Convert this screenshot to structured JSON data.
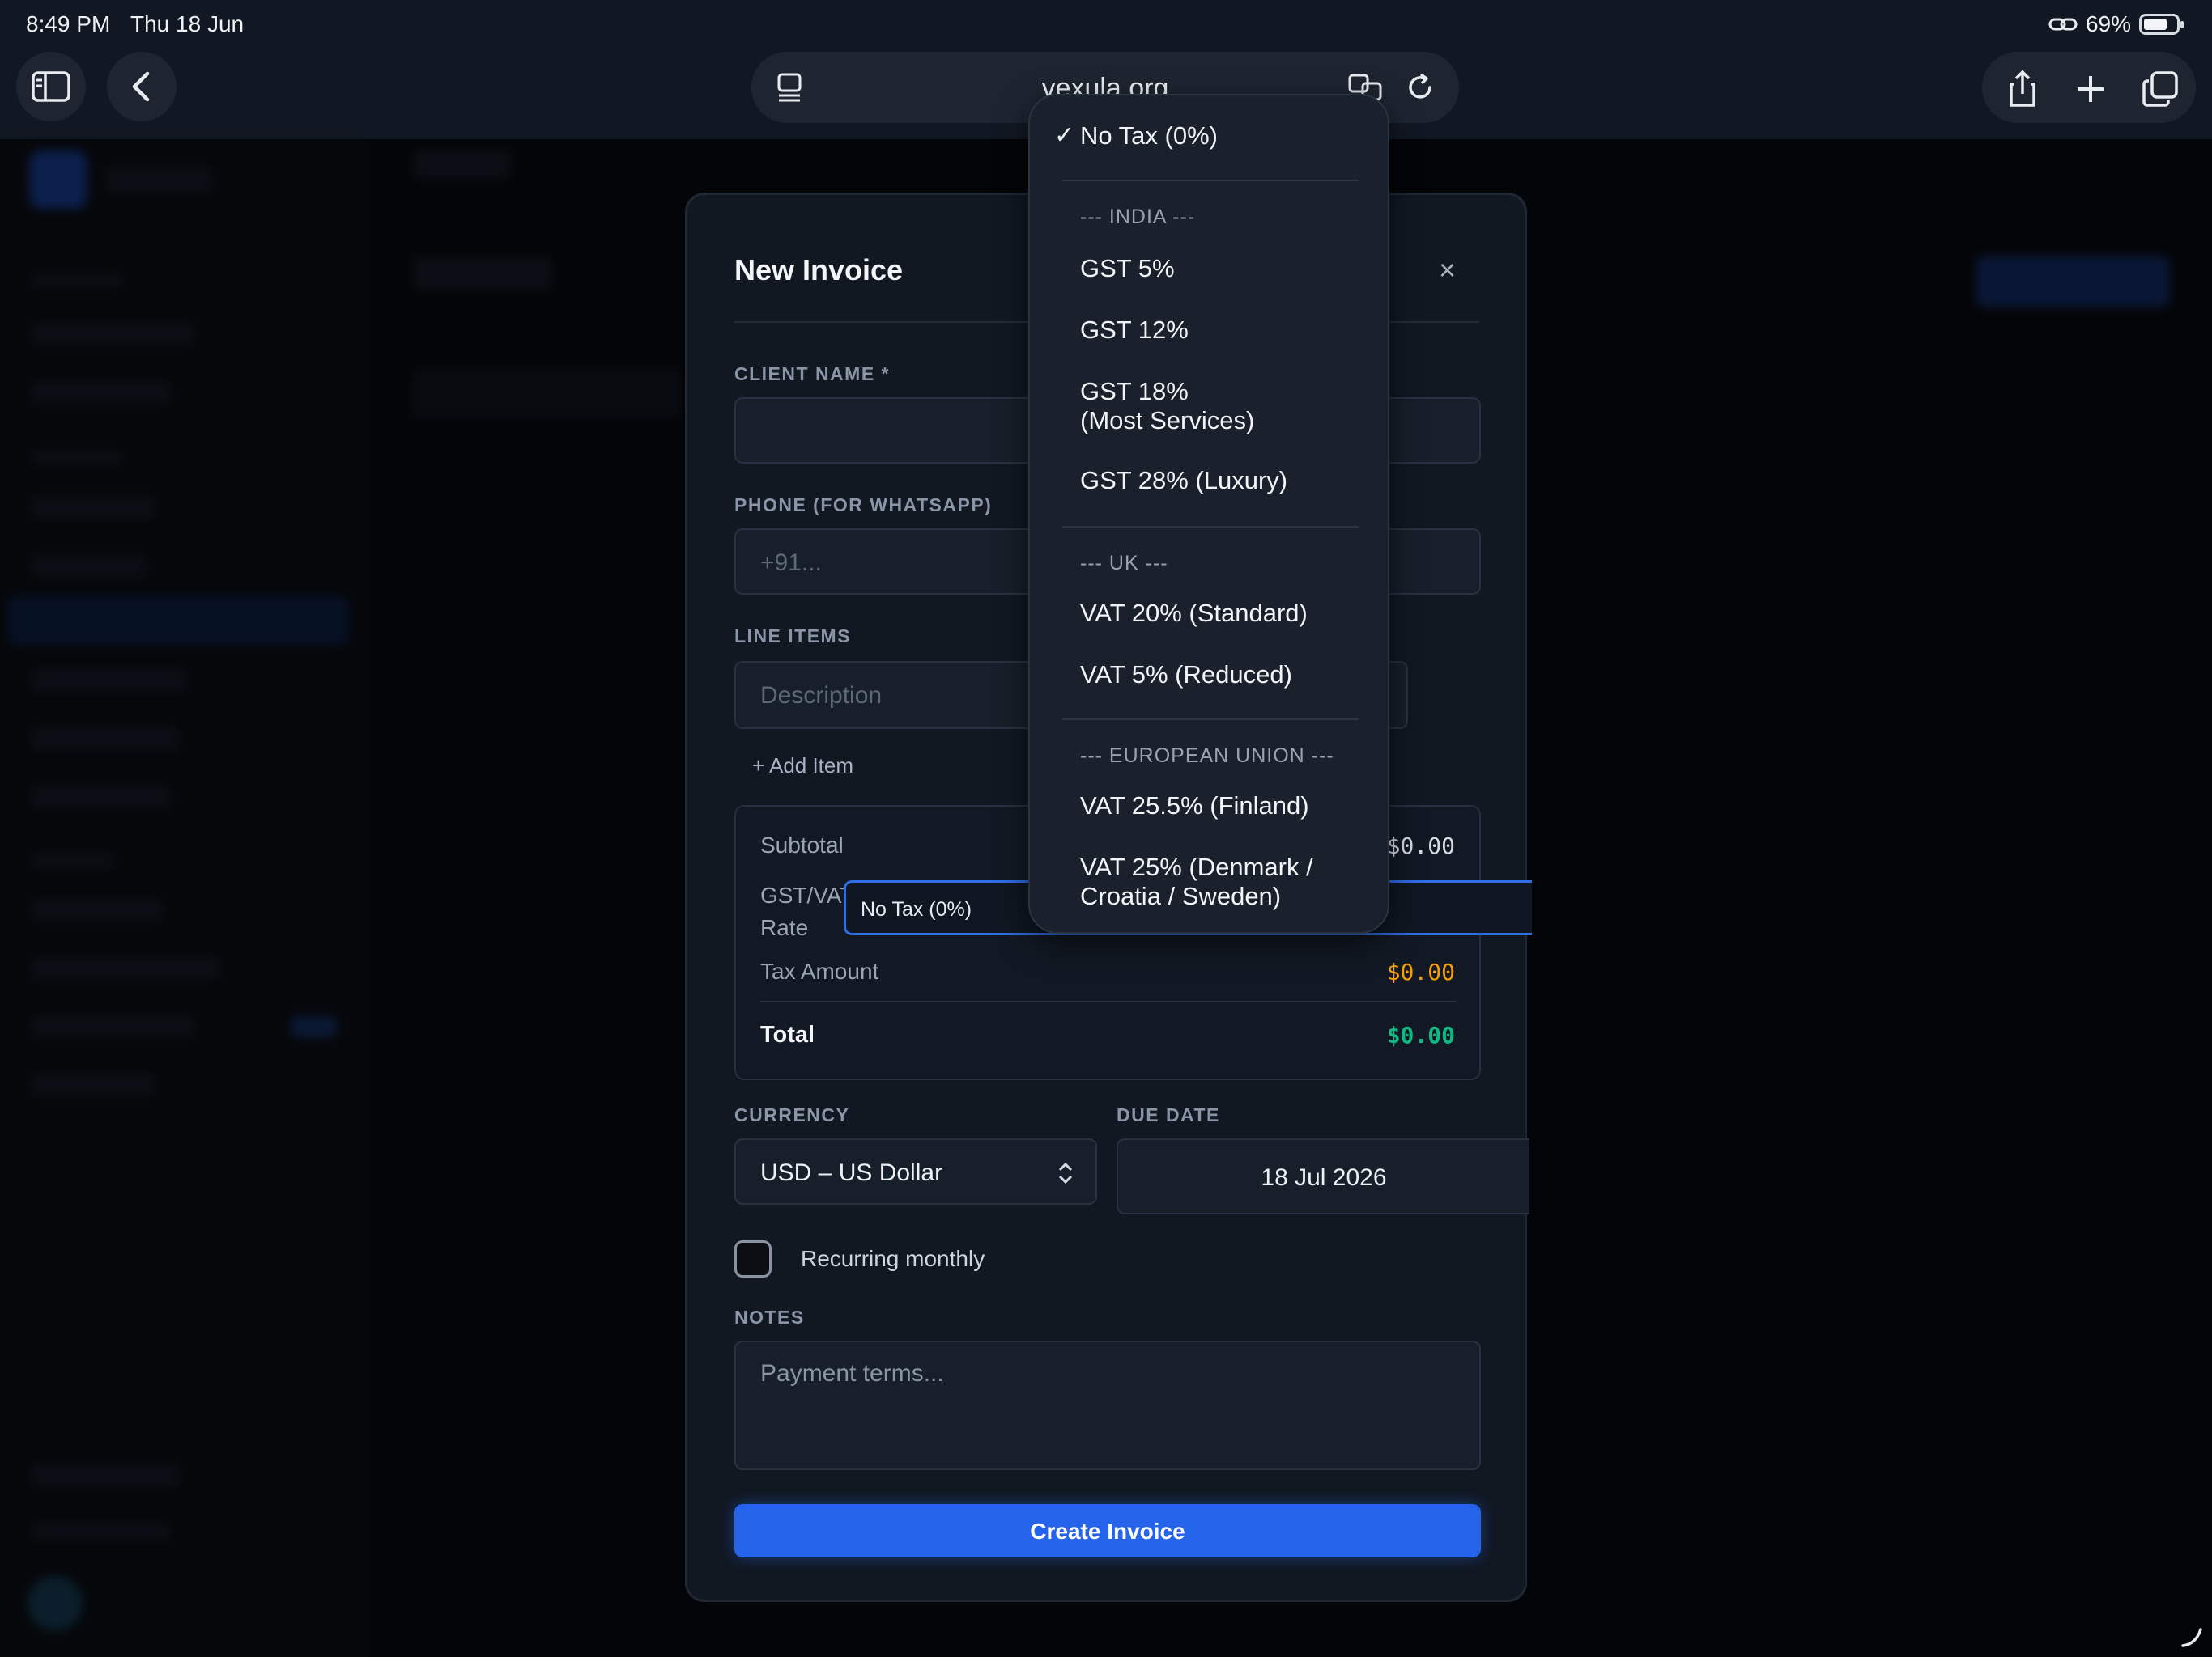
{
  "status_bar": {
    "time": "8:49 PM",
    "date": "Thu 18 Jun",
    "battery": "69%"
  },
  "browser": {
    "url": "vexula.org"
  },
  "modal": {
    "title": "New Invoice",
    "close": "×",
    "client_label": "CLIENT NAME *",
    "phone_label": "PHONE (FOR WHATSAPP)",
    "phone_placeholder": "+91...",
    "line_items_label": "LINE ITEMS",
    "description_placeholder": "Description",
    "add_item": "+ Add Item",
    "summary": {
      "subtotal_label": "Subtotal",
      "subtotal_value": "$0.00",
      "rate_label_1": "GST/VAT",
      "rate_label_2": "Rate",
      "tax_select_value": "No Tax (0%)",
      "tax_amount_label": "Tax Amount",
      "tax_amount_value": "$0.00",
      "total_label": "Total",
      "total_value": "$0.00"
    },
    "currency_label": "CURRENCY",
    "currency_value": "USD – US Dollar",
    "due_date_label": "DUE DATE",
    "due_date_value": "18 Jul 2026",
    "recurring_label": "Recurring monthly",
    "notes_label": "NOTES",
    "notes_placeholder": "Payment terms...",
    "create_button": "Create Invoice"
  },
  "dropdown": {
    "selected_check": "✓",
    "no_tax": "No Tax (0%)",
    "india_group": "--- INDIA ---",
    "gst5": "GST 5%",
    "gst12": "GST 12%",
    "gst18_line1": "GST 18%",
    "gst18_line2": "(Most Services)",
    "gst28": "GST 28% (Luxury)",
    "uk_group": "--- UK ---",
    "vat20": "VAT 20% (Standard)",
    "vat5": "VAT 5% (Reduced)",
    "eu_group": "--- EUROPEAN UNION ---",
    "vat255": "VAT 25.5% (Finland)",
    "vat25_line1": "VAT 25% (Denmark /",
    "vat25_line2": "Croatia / Sweden)"
  },
  "colors": {
    "accent": "#2563eb",
    "tax_amount": "#f59e0b",
    "total": "#10b981"
  },
  "icons": [
    "sidebar-icon",
    "back-icon",
    "reader-icon",
    "translate-icon",
    "reload-icon",
    "share-icon",
    "plus-icon",
    "tabs-icon",
    "link-icon",
    "battery-icon",
    "select-arrows-icon",
    "close-icon",
    "checkmark-icon"
  ]
}
